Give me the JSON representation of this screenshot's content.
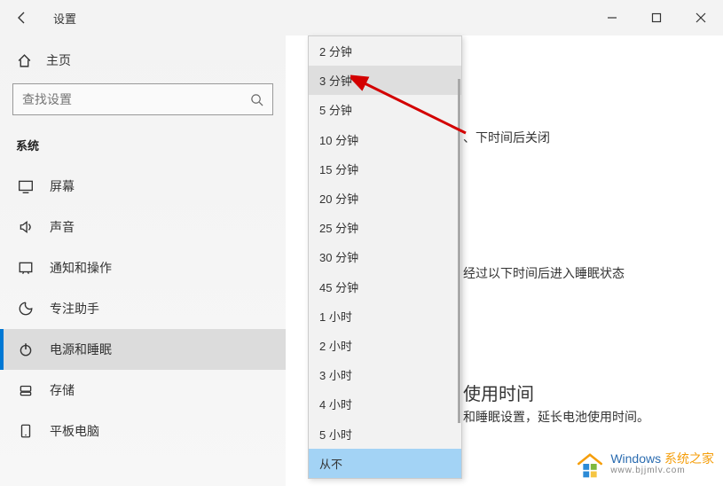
{
  "titlebar": {
    "title": "设置"
  },
  "sidebar": {
    "home_label": "主页",
    "search_placeholder": "查找设置",
    "section_label": "系统",
    "items": [
      {
        "label": "屏幕"
      },
      {
        "label": "声音"
      },
      {
        "label": "通知和操作"
      },
      {
        "label": "专注助手"
      },
      {
        "label": "电源和睡眠"
      },
      {
        "label": "存储"
      },
      {
        "label": "平板电脑"
      }
    ]
  },
  "content": {
    "text1": "、下时间后关闭",
    "text2": "经过以下时间后进入睡眠状态",
    "heading": "使用时间",
    "text3": "和睡眠设置，延长电池使用时间。"
  },
  "dropdown": {
    "options": [
      "2 分钟",
      "3 分钟",
      "5 分钟",
      "10 分钟",
      "15 分钟",
      "20 分钟",
      "25 分钟",
      "30 分钟",
      "45 分钟",
      "1 小时",
      "2 小时",
      "3 小时",
      "4 小时",
      "5 小时",
      "从不"
    ],
    "hovered_index": 1,
    "selected_index": 14
  },
  "watermark": {
    "brand1": "Windows",
    "brand2": "系统之家",
    "url": "www.bjjmlv.com"
  }
}
